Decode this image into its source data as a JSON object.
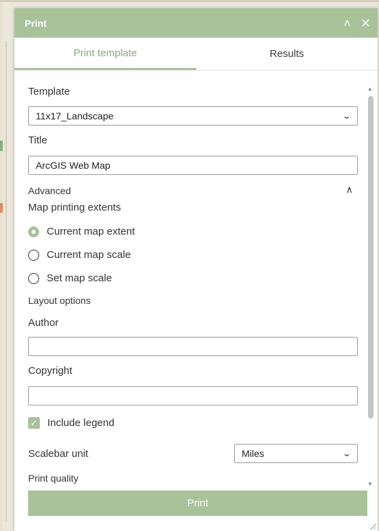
{
  "panel": {
    "title": "Print",
    "collapse_icon": "double-chevron-up-icon",
    "close_icon": "close-icon"
  },
  "tabs": [
    {
      "label": "Print template",
      "active": true
    },
    {
      "label": "Results",
      "active": false
    }
  ],
  "form": {
    "template_label": "Template",
    "template_value": "11x17_Landscape",
    "title_label": "Title",
    "title_value": "ArcGIS Web Map",
    "advanced_label": "Advanced",
    "extents_label": "Map printing extents",
    "extent_options": [
      {
        "label": "Current map extent",
        "checked": true
      },
      {
        "label": "Current map scale",
        "checked": false
      },
      {
        "label": "Set map scale",
        "checked": false
      }
    ],
    "layout_options_label": "Layout options",
    "author_label": "Author",
    "author_value": "",
    "copyright_label": "Copyright",
    "copyright_value": "",
    "include_legend_label": "Include legend",
    "include_legend_checked": true,
    "scalebar_label": "Scalebar unit",
    "scalebar_value": "Miles",
    "print_quality_label": "Print quality"
  },
  "actions": {
    "print_label": "Print"
  },
  "colors": {
    "accent": "#a9c29a",
    "accent_text": "#8aa97c"
  }
}
